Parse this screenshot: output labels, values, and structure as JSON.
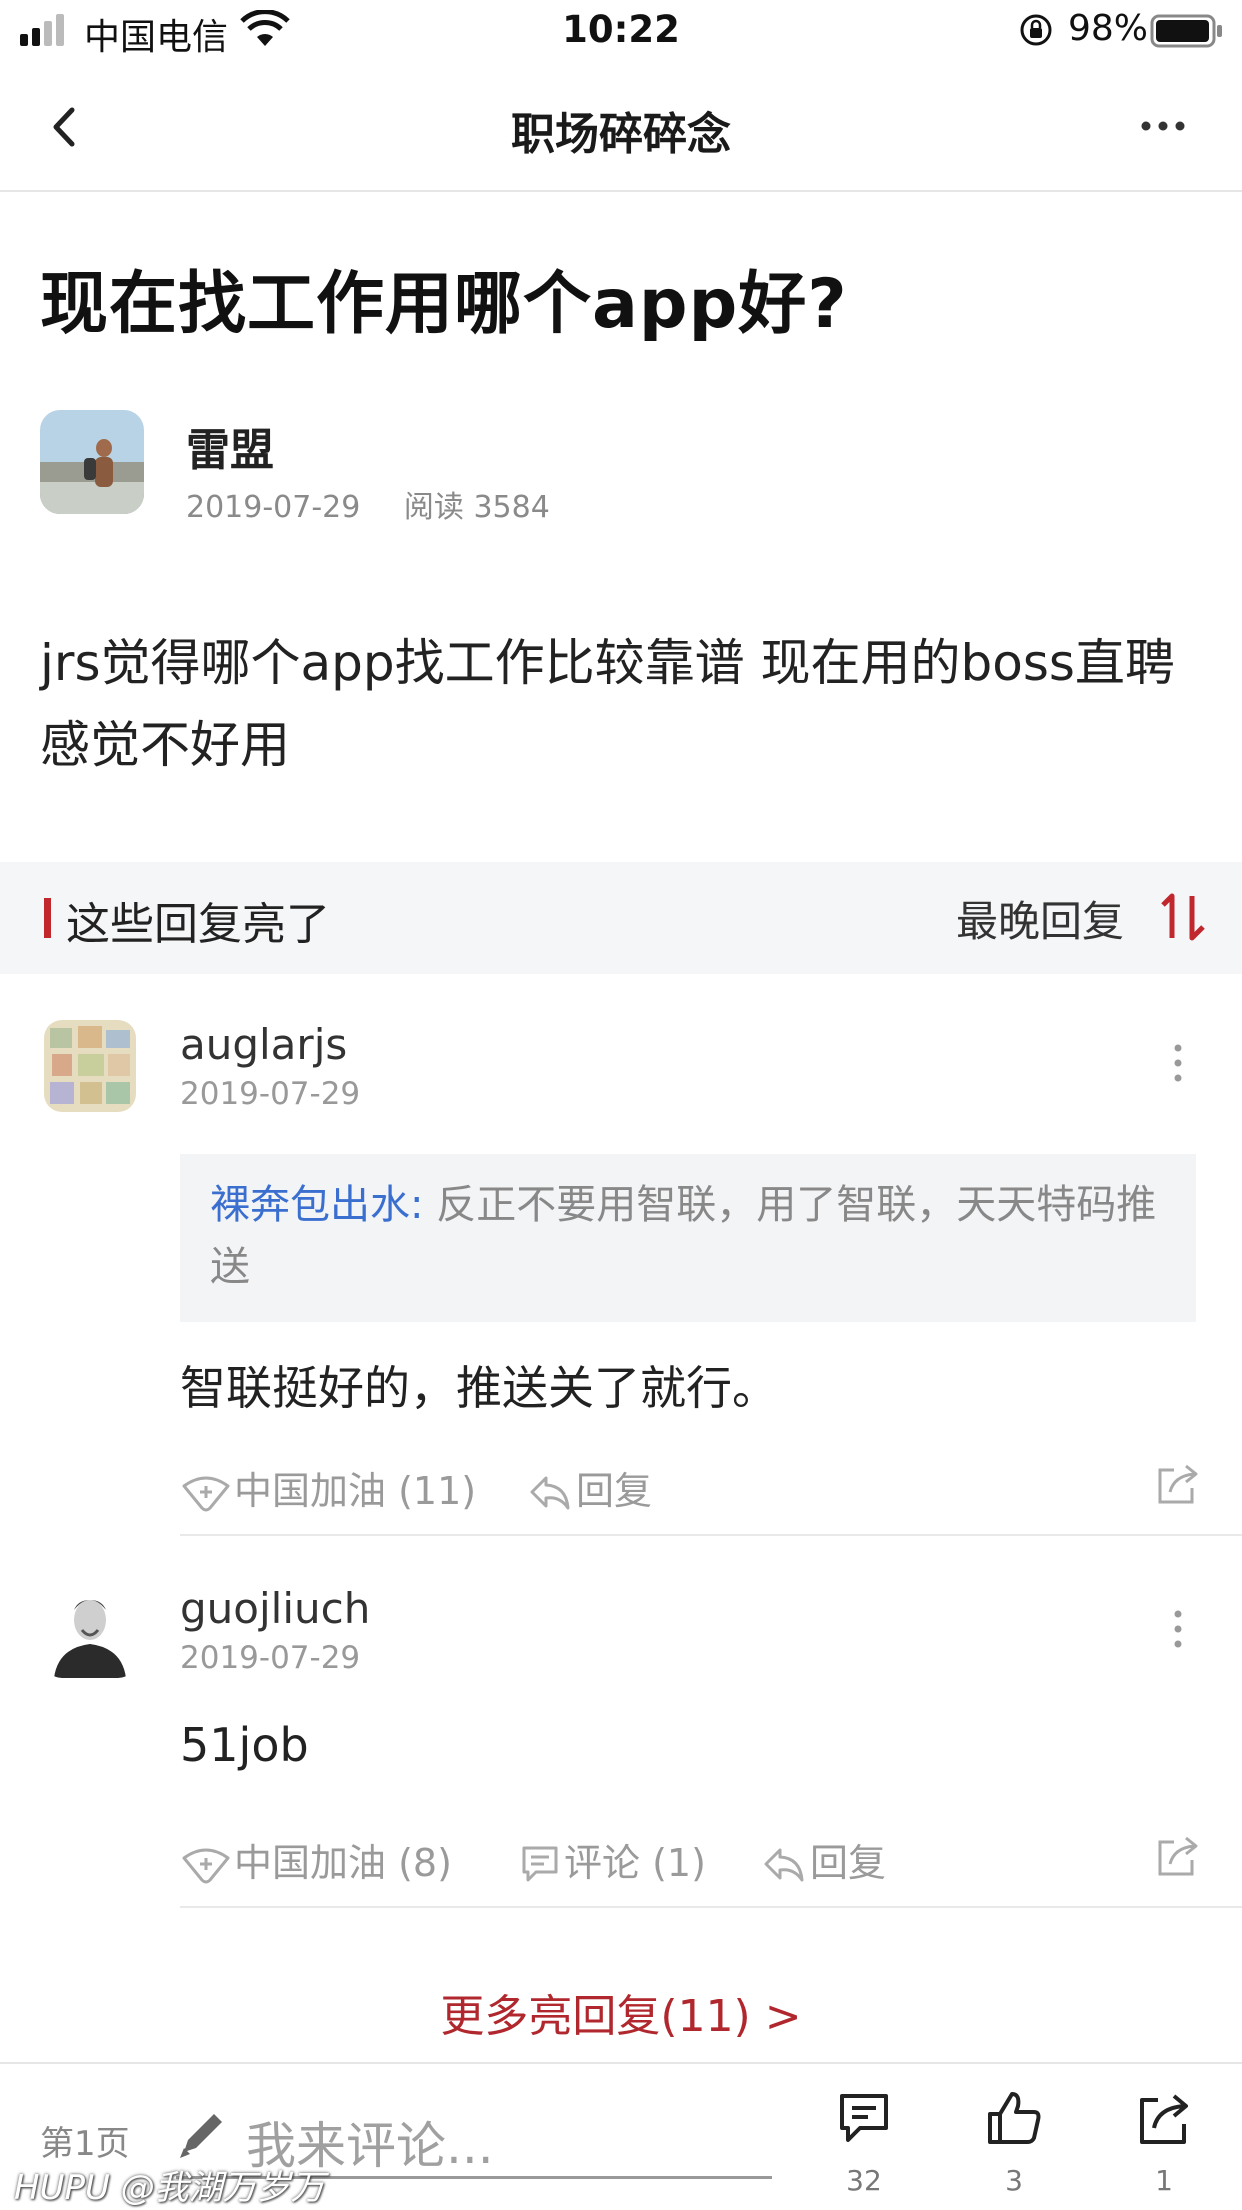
{
  "status_bar": {
    "carrier": "中国电信",
    "time": "10:22",
    "battery": "98%"
  },
  "nav": {
    "title": "职场碎碎念"
  },
  "post": {
    "title": "现在找工作用哪个app好?",
    "author": "雷盟",
    "date": "2019-07-29",
    "reads": "阅读 3584",
    "body": "jrs觉得哪个app找工作比较靠谱 现在用的boss直聘感觉不好用"
  },
  "section": {
    "label": "这些回复亮了",
    "sort_label": "最晚回复"
  },
  "replies": [
    {
      "user": "auglarjs",
      "date": "2019-07-29",
      "quote_user": "裸奔包出水:",
      "quote_text": " 反正不要用智联，用了智联，天天特码推送",
      "text": "智联挺好的，推送关了就行。",
      "light": "中国加油 (11)",
      "reply": "回复"
    },
    {
      "user": "guojliuch",
      "date": "2019-07-29",
      "text": "51job",
      "light": "中国加油 (8)",
      "comment": "评论 (1)",
      "reply": "回复"
    }
  ],
  "more_replies": "更多亮回复(11) >",
  "bottom_bar": {
    "page": "第1页",
    "placeholder": "我来评论...",
    "comments": "32",
    "likes": "3",
    "shares": "1"
  },
  "watermark": "HUPU @我湖万岁万",
  "colors": {
    "accent": "#c0282e",
    "link": "#3a6fd0"
  }
}
